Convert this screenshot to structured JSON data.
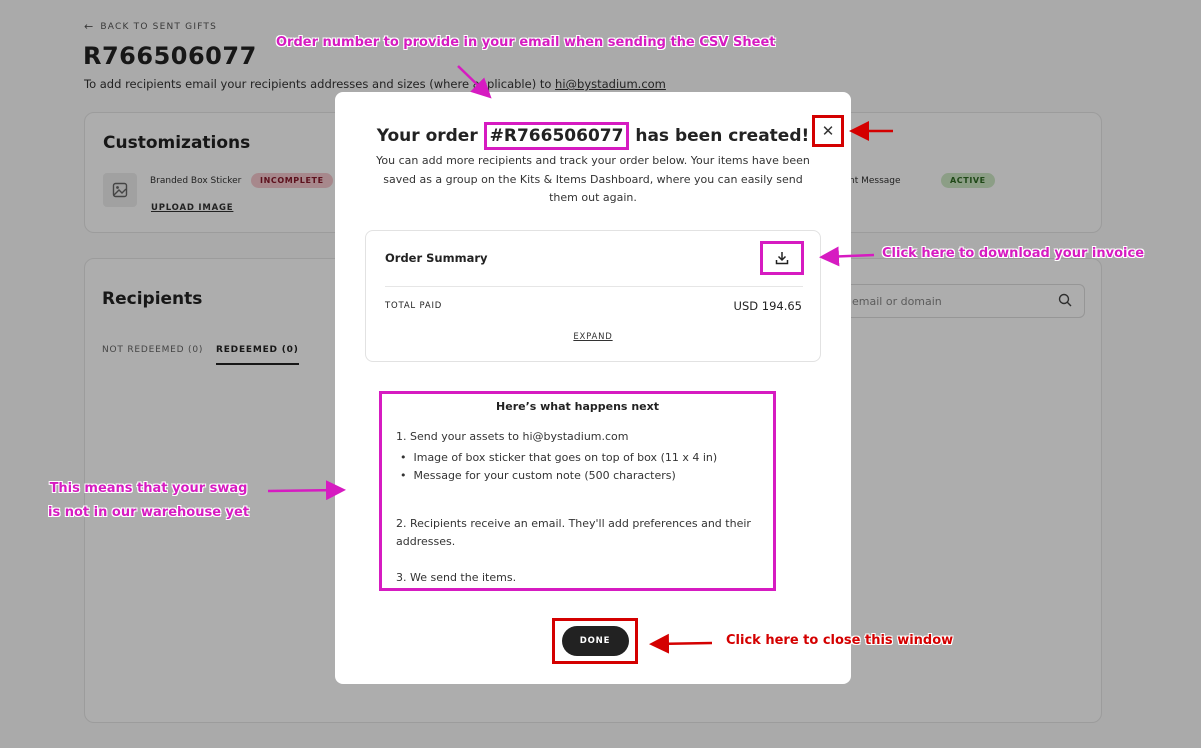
{
  "page": {
    "back_link": "BACK TO SENT GIFTS",
    "title": "R766506077",
    "subtitle": "To add recipients email your recipients addresses and sizes (where applicable) to",
    "subtitle_email": "hi@bystadium.com"
  },
  "customizations": {
    "title": "Customizations",
    "sticker_label": "Branded Box Sticker",
    "sticker_status": "INCOMPLETE",
    "upload_label": "UPLOAD IMAGE",
    "message_label": "nt Message",
    "message_status": "ACTIVE"
  },
  "recipients": {
    "title": "Recipients",
    "tabs": [
      "NOT REDEEMED (0)",
      "REDEEMED (0)"
    ],
    "search_placeholder": "email or domain"
  },
  "modal": {
    "title_prefix": "Your order",
    "order_number": "#R766506077",
    "title_suffix": "has been created!",
    "description": "You can add more recipients and track your order below. Your items have been saved as a group on the Kits & Items Dashboard, where you can easily send them out again.",
    "summary_title": "Order Summary",
    "total_paid_label": "TOTAL PAID",
    "total_paid_value": "USD 194.65",
    "expand_label": "EXPAND",
    "next_title": "Here’s what happens next",
    "step1": "1. Send your assets to hi@bystadium.com",
    "bullet1": "Image of box sticker that goes on top of box (11 x 4 in)",
    "bullet2": "Message for your custom note (500 characters)",
    "step2": "2. Recipients receive an email. They'll add preferences and their addresses.",
    "step3": "3. We send the items.",
    "done_label": "DONE"
  },
  "annotations": {
    "order_note": "Order number to provide in your email when sending the CSV Sheet",
    "invoice_note": "Click here to download your invoice",
    "swag_note_line1": "This means that your swag",
    "swag_note_line2": "is not in our warehouse yet",
    "close_note": "Click here to close this window"
  },
  "colors": {
    "annotation_magenta": "#d61bc1",
    "annotation_red": "#d40000",
    "badge_incomplete": "#f6c9cf",
    "badge_active": "#cfe9c6",
    "button_dark": "#222222"
  }
}
